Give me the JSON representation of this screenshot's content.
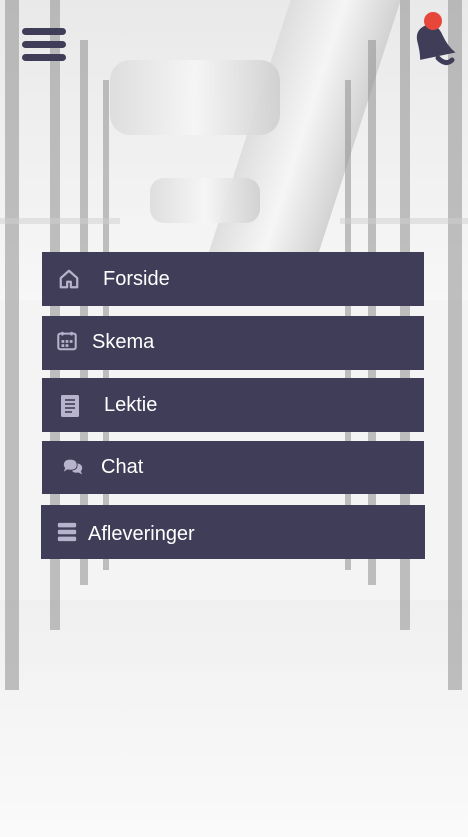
{
  "header": {
    "menu_icon": "hamburger-menu-icon",
    "notifications_icon": "bell-icon",
    "notification_badge_color": "#e7463a"
  },
  "colors": {
    "accent": "#403d58",
    "icon_tint": "#b7b3cc",
    "badge": "#e7463a"
  },
  "menu": {
    "items": [
      {
        "label": "Forside",
        "icon": "home-icon"
      },
      {
        "label": "Skema",
        "icon": "calendar-icon"
      },
      {
        "label": "Lektie",
        "icon": "book-icon"
      },
      {
        "label": "Chat",
        "icon": "chat-bubbles-icon"
      },
      {
        "label": "Afleveringer",
        "icon": "list-icon"
      }
    ]
  }
}
